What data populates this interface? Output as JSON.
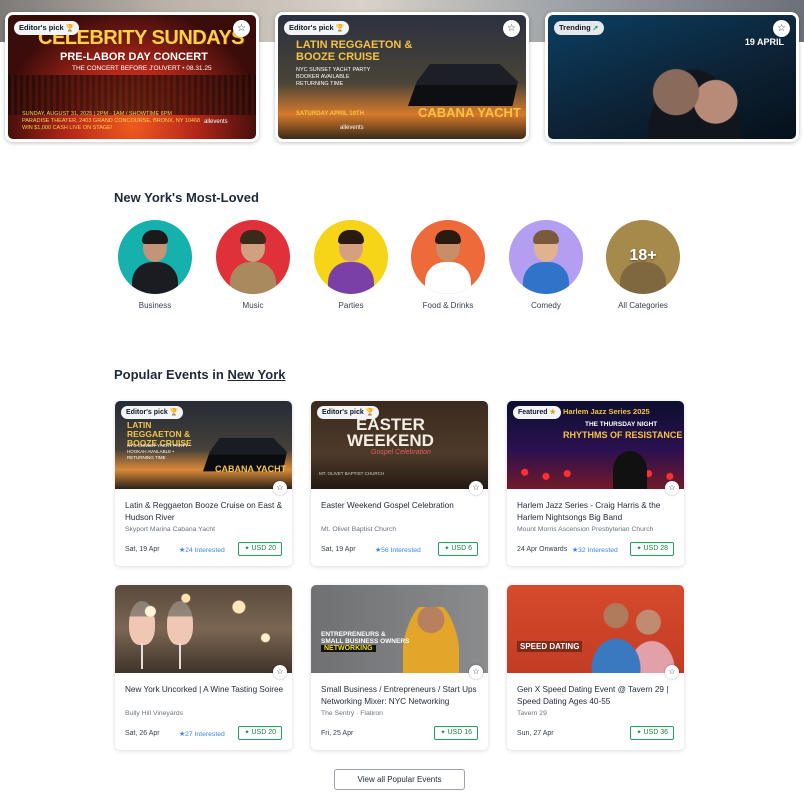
{
  "hero": {
    "cards": [
      {
        "badge": "Editor's pick",
        "title_line1": "CELEBRITY SUNDAYS",
        "title_line2": "PRE-LABOR DAY CONCERT",
        "subtitle": "THE CONCERT BEFORE J'OUVERT • 08.31.25",
        "info_line1": "SUNDAY, AUGUST 31, 2025 | 2PM - 1AM / SHOWTIME 6PM",
        "info_line2": "PARADISE THEATER, 2403 GRAND CONCOURSE, BRONX, NY 10468",
        "info_line3": "WIN $1,000 CASH LIVE ON STAGE!",
        "logo": "allevents"
      },
      {
        "badge": "Editor's pick",
        "title_line1": "LATIN REGGAETON &",
        "title_line2": "BOOZE CRUISE",
        "detail1": "NYC SUNSET YACHT PARTY",
        "detail2": "BOOKER AVAILABLE",
        "detail3": "RETURNING TIME",
        "date_line": "SATURDAY APRIL 19TH",
        "venue": "CABANA YACHT",
        "logo": "allevents"
      },
      {
        "badge": "Trending",
        "date": "19 APRIL"
      }
    ]
  },
  "most_loved": {
    "title": "New York's Most-Loved",
    "categories": [
      {
        "label": "Business",
        "color": "#16b0ad"
      },
      {
        "label": "Music",
        "color": "#e0303a"
      },
      {
        "label": "Parties",
        "color": "#f6d417"
      },
      {
        "label": "Food & Drinks",
        "color": "#ef6a3a"
      },
      {
        "label": "Comedy",
        "color": "#b39ef2"
      },
      {
        "label": "All Categories",
        "color": "#a58a4c",
        "overlay": "18+"
      }
    ]
  },
  "popular": {
    "title_prefix": "Popular Events in",
    "city": "New York",
    "events": [
      {
        "badge": "Editor's pick",
        "thumb_title": "LATIN REGGAETON & BOOZE CRUISE",
        "thumb_detail": "NYC SUNSET YACHT PARTY • HOOKAH AVAILABLE • RETURNING TIME",
        "thumb_venue": "CABANA YACHT",
        "title": "Latin & Reggaeton Booze Cruise on East & Hudson River",
        "venue": "Skyport Marina Cabana Yacht",
        "date": "Sat, 19 Apr",
        "interested": "24 Interested",
        "price": "USD 20"
      },
      {
        "badge": "Editor's pick",
        "thumb_title_line1": "EASTER",
        "thumb_title_line2": "WEEKEND",
        "thumb_script": "Gospel Celebration",
        "thumb_detail": "MT. OLIVET BAPTIST CHURCH",
        "title": "Easter Weekend Gospel Celebration",
        "venue": "Mt. Olivet Baptist Church",
        "date": "Sat, 19 Apr",
        "interested": "56 Interested",
        "price": "USD 6"
      },
      {
        "badge": "Featured",
        "thumb_series": "Harlem Jazz Series 2025",
        "thumb_sub": "THE THURSDAY NIGHT",
        "thumb_title": "RHYTHMS OF RESISTANCE",
        "title": "Harlem Jazz Series - Craig Harris & the Harlem Nightsongs Big Band",
        "venue": "Mount Morris Ascension Presbyterian Church",
        "date": "24 Apr Onwards",
        "interested": "32 Interested",
        "price": "USD 28"
      },
      {
        "badge": "",
        "title": "New York Uncorked | A Wine Tasting Soiree",
        "venue": "Bully Hill Vineyards",
        "date": "Sat, 26 Apr",
        "interested": "27 Interested",
        "price": "USD 20"
      },
      {
        "badge": "",
        "thumb_line1": "ENTREPRENEURS &",
        "thumb_line2": "SMALL BUSINESS OWNERS",
        "thumb_highlight": "NETWORKING",
        "title": "Small Business / Entrepreneurs / Start Ups Networking Mixer: NYC Networking",
        "venue": "The Sentry · Flatiron",
        "date": "Fri, 25 Apr",
        "interested": "",
        "price": "USD 16"
      },
      {
        "badge": "",
        "thumb_title": "SPEED DATING",
        "title": "Gen X Speed Dating Event @ Tavern 29 | Speed Dating Ages 40-55",
        "venue": "Tavern 29",
        "date": "Sun, 27 Apr",
        "interested": "",
        "price": "USD 36"
      }
    ],
    "view_all_label": "View all Popular Events"
  },
  "colors": {
    "interested_blue": "#3b82f6",
    "price_green": "#15803d",
    "badge_gold": "#d4a017"
  }
}
